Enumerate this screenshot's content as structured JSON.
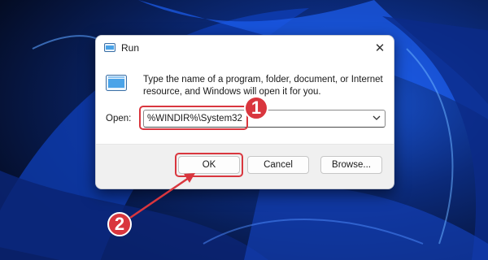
{
  "colors": {
    "accent_red": "#d9363e",
    "wallpaper_dark": "#061436",
    "wallpaper_blue": "#1a56d6"
  },
  "dialog": {
    "title": "Run",
    "title_icon": "run-app-icon",
    "close_icon": "close-icon",
    "close_glyph": "✕",
    "description": "Type the name of a program, folder, document, or Internet resource, and Windows will open it for you.",
    "open_label": "Open:",
    "open_value": "%WINDIR%\\System32",
    "dropdown_icon": "chevron-down-icon",
    "buttons": {
      "ok": "OK",
      "cancel": "Cancel",
      "browse": "Browse..."
    }
  },
  "annotations": {
    "step1": "1",
    "step2": "2"
  }
}
